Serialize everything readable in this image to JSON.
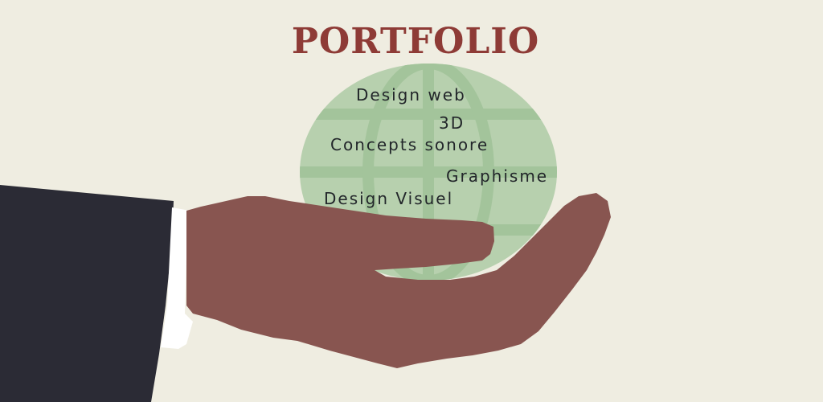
{
  "title": "PORTFOLIO",
  "topics": [
    "Design web",
    "3D",
    "Concepts sonore",
    "Graphisme",
    "Design Visuel"
  ],
  "colors": {
    "background": "#efede1",
    "title": "#8e3b36",
    "globe": "#b7d0ae",
    "globe_lines": "#a3c49b",
    "hand": "#885550",
    "sleeve": "#2b2b35",
    "cuff": "#ffffff",
    "text": "#22262a"
  },
  "icons": [
    "globe-icon"
  ]
}
